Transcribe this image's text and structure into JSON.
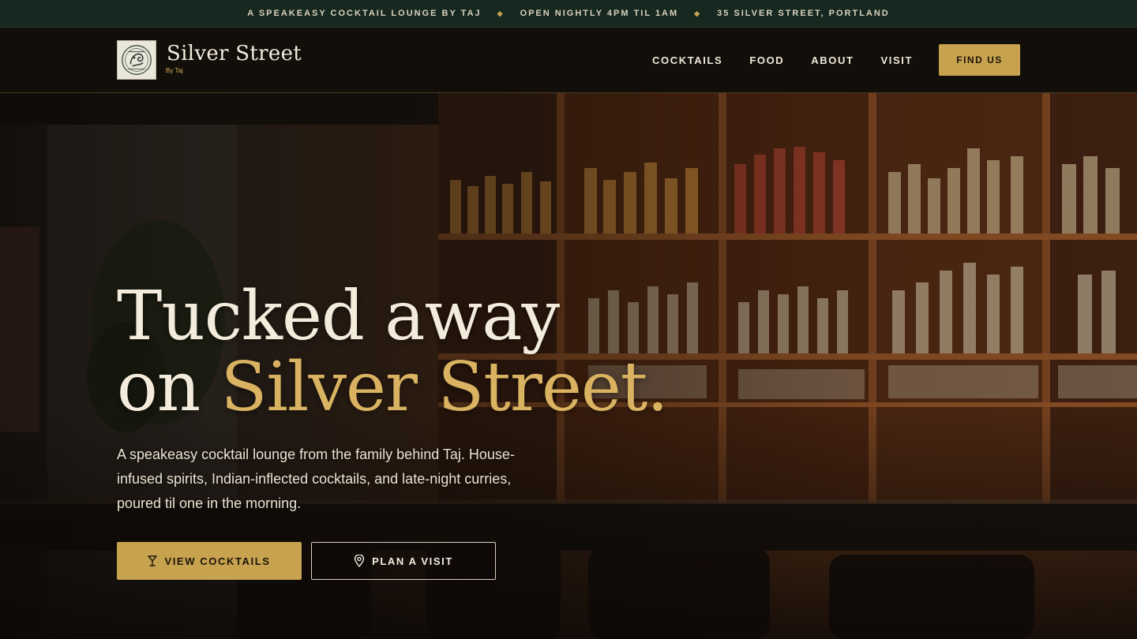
{
  "topbar": {
    "items": [
      "A SPEAKEASY COCKTAIL LOUNGE BY TAJ",
      "OPEN NIGHTLY 4PM TIL 1AM",
      "35 SILVER STREET, PORTLAND"
    ],
    "separator": "◆"
  },
  "brand": {
    "name": "Silver Street",
    "sub": "By Taj"
  },
  "nav": {
    "links": [
      "COCKTAILS",
      "FOOD",
      "ABOUT",
      "VISIT"
    ],
    "cta": "FIND US"
  },
  "hero": {
    "headline_line1": "Tucked away",
    "headline_line2_prefix": "on ",
    "headline_line2_accent": "Silver Street.",
    "lede": "A speakeasy cocktail lounge from the family behind Taj. House-infused spirits, Indian-inflected cocktails, and late-night curries, poured til one in the morning.",
    "primary_button": {
      "label": "VIEW COCKTAILS",
      "icon": "cocktail-glass-icon"
    },
    "secondary_button": {
      "label": "PLAN A VISIT",
      "icon": "map-pin-icon"
    }
  },
  "colors": {
    "topbar_bg": "#16281f",
    "nav_bg": "#120e0a",
    "accent_gold": "#c8a34f",
    "headline_accent": "#d9b361",
    "text_cream": "#f3ecdc"
  }
}
